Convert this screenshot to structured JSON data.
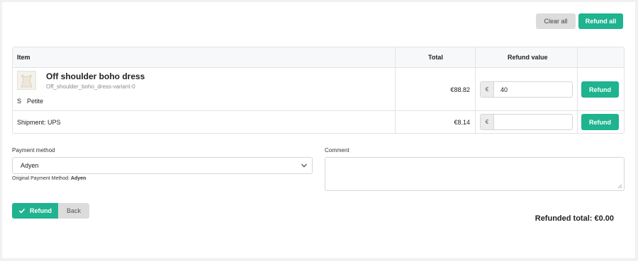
{
  "toolbar": {
    "clear_all_label": "Clear all",
    "refund_all_label": "Refund all"
  },
  "table": {
    "headers": {
      "item": "Item",
      "total": "Total",
      "refund_value": "Refund value"
    },
    "rows": [
      {
        "name": "Off shoulder boho dress",
        "sku": "Off_shoulder_boho_dress-variant-0",
        "size": "S",
        "fit": "Petite",
        "total": "€88.82",
        "currency": "€",
        "refund_value": "40",
        "refund_label": "Refund"
      },
      {
        "name": "Shipment: UPS",
        "total": "€8.14",
        "currency": "€",
        "refund_value": "",
        "refund_label": "Refund"
      }
    ]
  },
  "payment": {
    "label": "Payment method",
    "selected": "Adyen",
    "original_prefix": "Original Payment Method:",
    "original_value": "Adyen"
  },
  "comment": {
    "label": "Comment",
    "value": ""
  },
  "actions": {
    "refund_label": "Refund",
    "back_label": "Back"
  },
  "summary": {
    "refunded_total": "Refunded total: €0.00"
  },
  "colors": {
    "accent": "#1fb38f",
    "grey_button": "#dcdcdc"
  }
}
